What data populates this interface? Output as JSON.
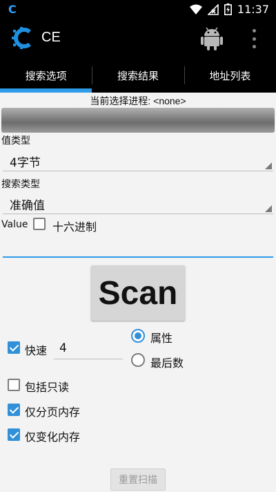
{
  "status_bar": {
    "time": "11:37"
  },
  "app": {
    "title": "CE"
  },
  "tabs": [
    {
      "label": "搜索选项",
      "active": true
    },
    {
      "label": "搜索结果",
      "active": false
    },
    {
      "label": "地址列表",
      "active": false
    }
  ],
  "process": {
    "label": "当前选择进程: <none>"
  },
  "value_type": {
    "label": "值类型",
    "selected": "4字节"
  },
  "scan_type": {
    "label": "搜索类型",
    "selected": "准确值"
  },
  "value": {
    "label": "Value",
    "hex_label": "十六进制",
    "hex_checked": false,
    "input_value": ""
  },
  "scan_button": {
    "label": "Scan"
  },
  "options": {
    "fast": {
      "label": "快速",
      "checked": true,
      "value": "4"
    },
    "attribute": {
      "label": "属性",
      "selected": true
    },
    "last_digits": {
      "label": "最后数",
      "selected": false
    },
    "include_readonly": {
      "label": "包括只读",
      "checked": false
    },
    "paged_only": {
      "label": "仅分页内存",
      "checked": true
    },
    "changed_only": {
      "label": "仅变化内存",
      "checked": true
    }
  },
  "reset_button": {
    "label": "重置扫描"
  },
  "colors": {
    "accent": "#2d9be8",
    "bar_bg": "#000000",
    "content_bg": "#f3f3f3"
  }
}
